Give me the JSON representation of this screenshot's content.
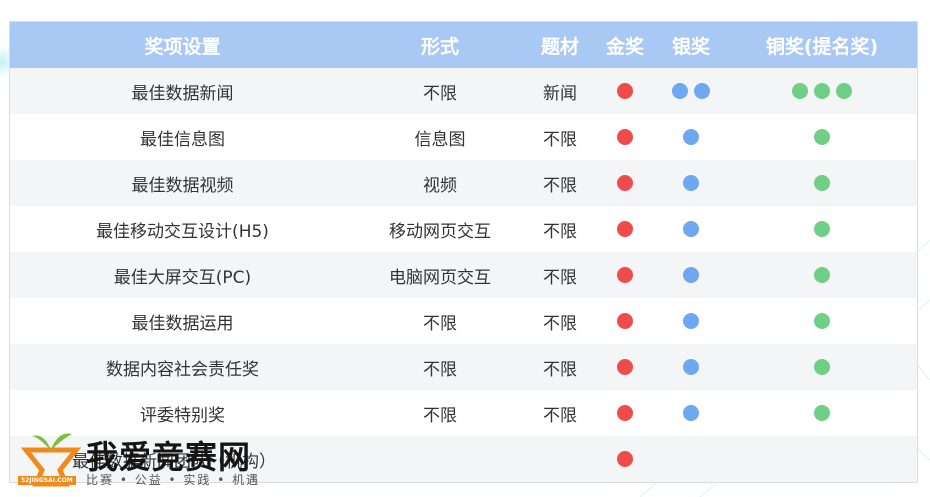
{
  "table": {
    "headers": [
      "奖项设置",
      "形式",
      "题材",
      "金奖",
      "银奖",
      "铜奖(提名奖)"
    ],
    "rows": [
      {
        "award": "最佳数据新闻",
        "form": "不限",
        "topic": "新闻",
        "gold": 1,
        "silver": 2,
        "bronze": 3
      },
      {
        "award": "最佳信息图",
        "form": "信息图",
        "topic": "不限",
        "gold": 1,
        "silver": 1,
        "bronze": 1
      },
      {
        "award": "最佳数据视频",
        "form": "视频",
        "topic": "不限",
        "gold": 1,
        "silver": 1,
        "bronze": 1
      },
      {
        "award": "最佳移动交互设计(H5)",
        "form": "移动网页交互",
        "topic": "不限",
        "gold": 1,
        "silver": 1,
        "bronze": 1
      },
      {
        "award": "最佳大屏交互(PC)",
        "form": "电脑网页交互",
        "topic": "不限",
        "gold": 1,
        "silver": 1,
        "bronze": 1
      },
      {
        "award": "最佳数据运用",
        "form": "不限",
        "topic": "不限",
        "gold": 1,
        "silver": 1,
        "bronze": 1
      },
      {
        "award": "数据内容社会责任奖",
        "form": "不限",
        "topic": "不限",
        "gold": 1,
        "silver": 1,
        "bronze": 1
      },
      {
        "award": "评委特别奖",
        "form": "不限",
        "topic": "不限",
        "gold": 1,
        "silver": 1,
        "bronze": 1
      },
      {
        "award": "最佳数据新闻团队（机构）",
        "form": "",
        "topic": "",
        "gold": 1,
        "silver": 0,
        "bronze": 0
      }
    ]
  },
  "colors": {
    "gold": "#ef4b4b",
    "silver": "#6ea8f0",
    "bronze": "#6fcf84",
    "header": "#a9c8f3"
  },
  "watermark": {
    "name": "我爱竞赛网",
    "slogan": "比赛 • 公益 • 实践 • 机遇",
    "site": "52JINGSAI.COM"
  }
}
